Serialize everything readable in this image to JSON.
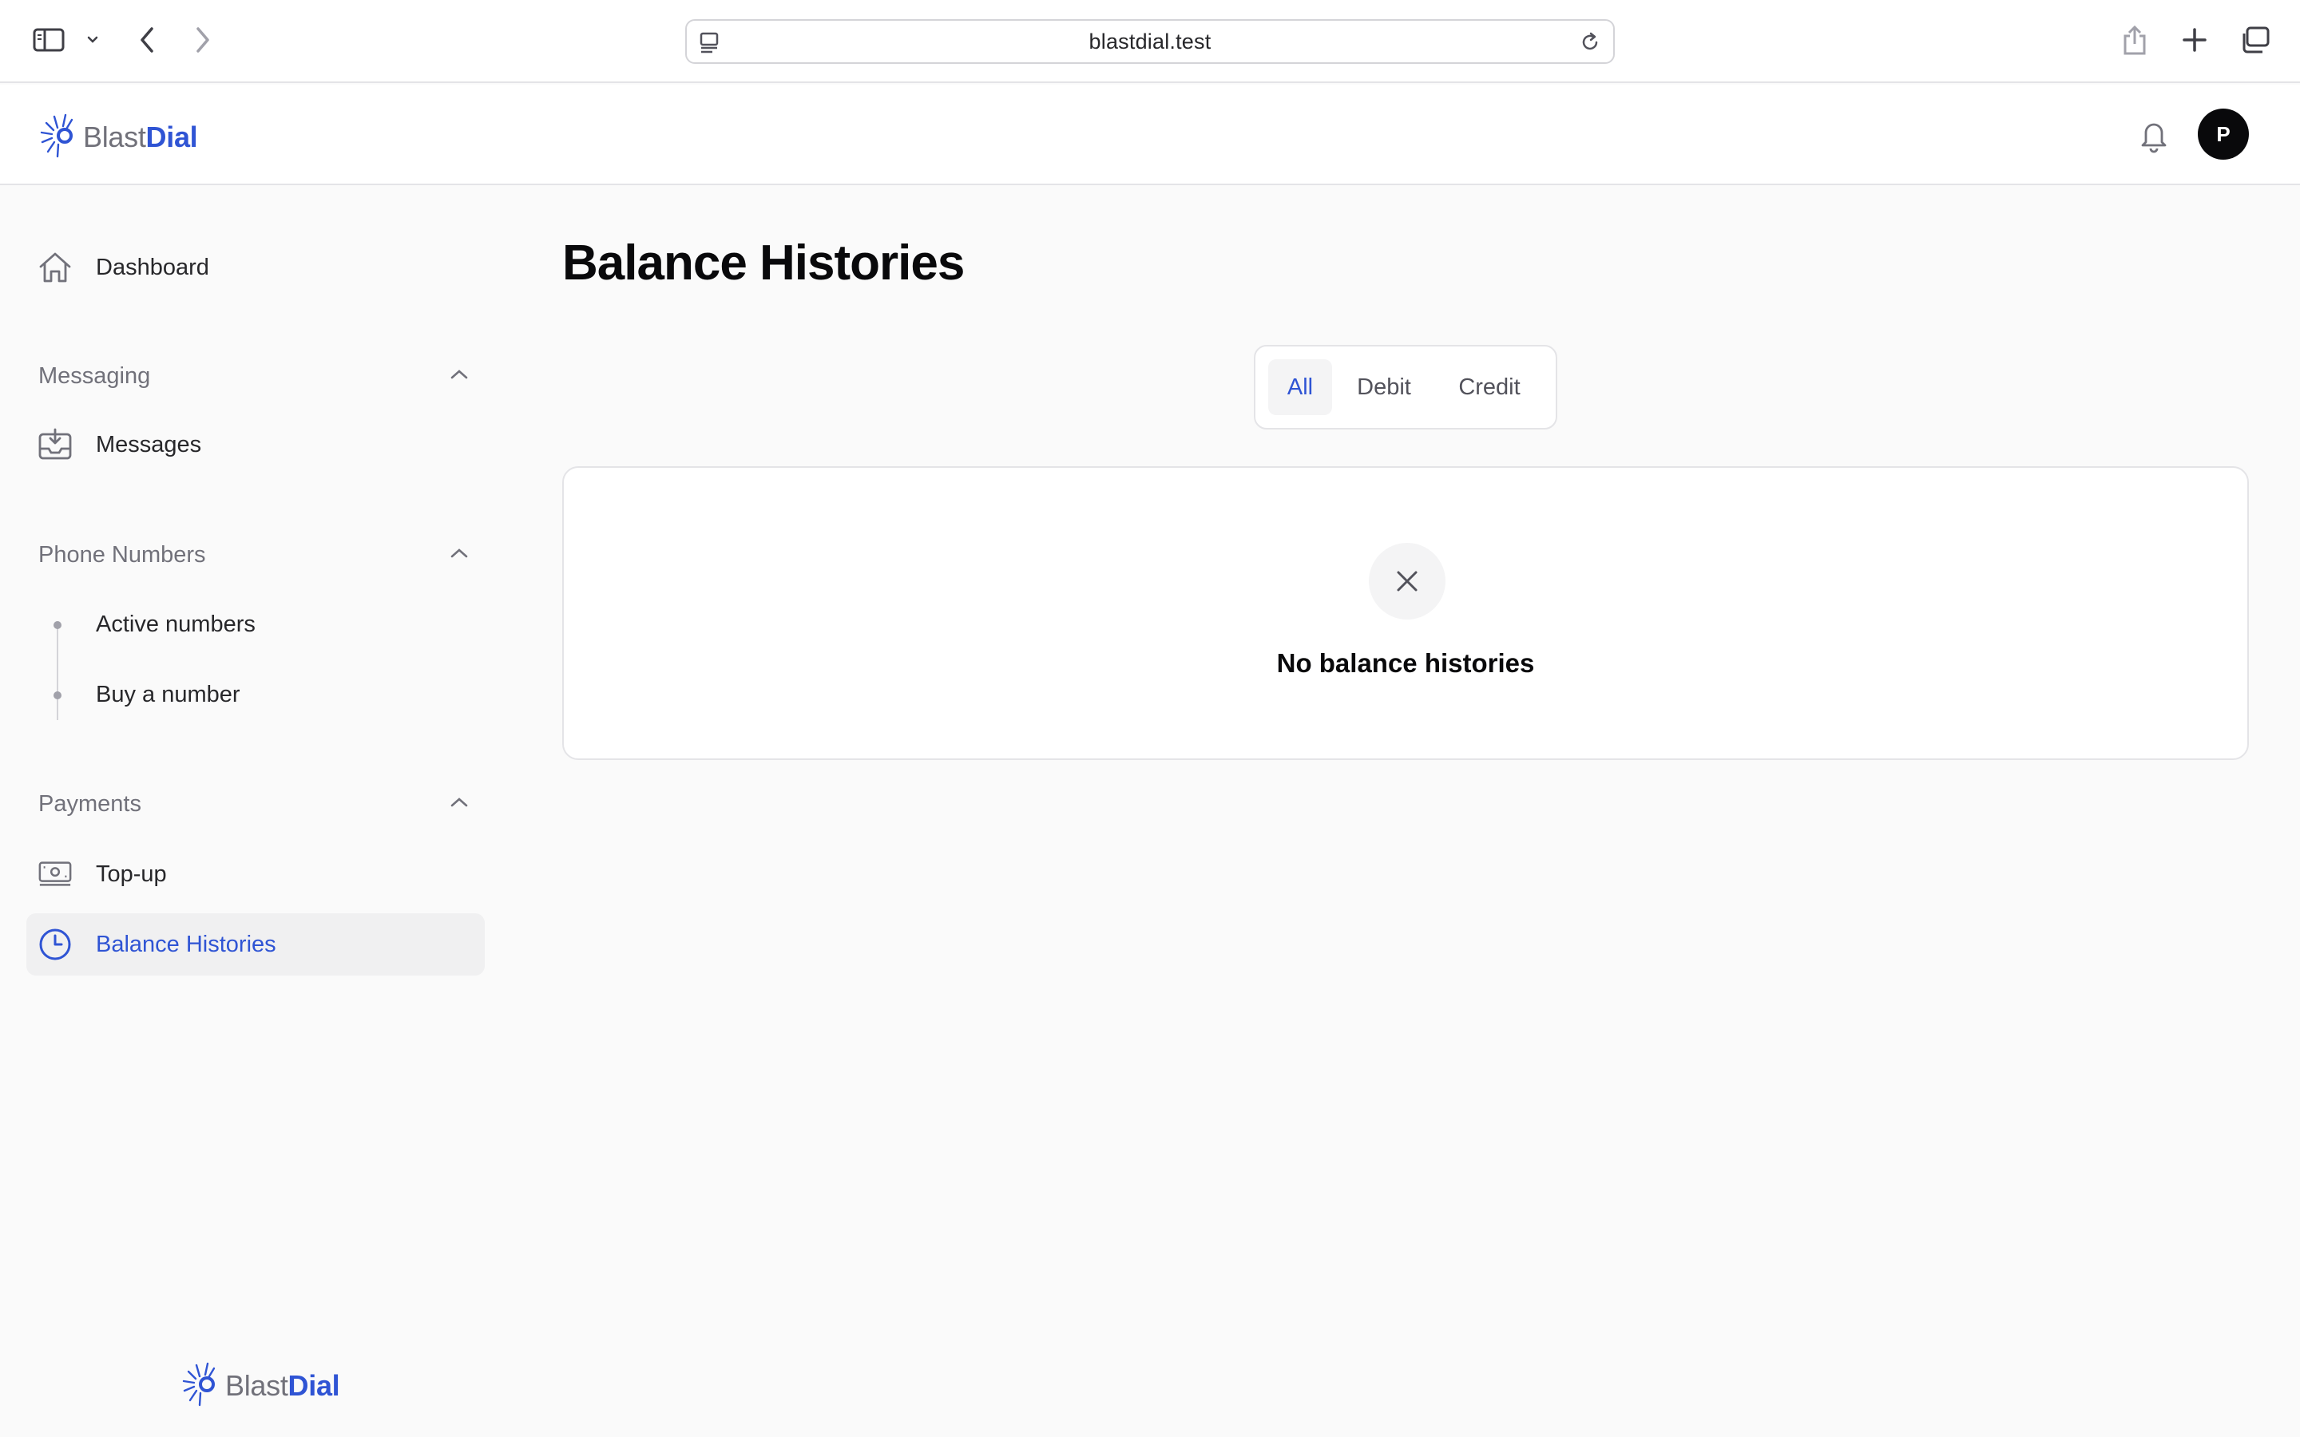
{
  "browser": {
    "url": "blastdial.test"
  },
  "brand": {
    "name_part1": "Blast",
    "name_part2": "Dial",
    "accent_color": "#2f54d4"
  },
  "header": {
    "avatar_initial": "P"
  },
  "sidebar": {
    "dashboard_label": "Dashboard",
    "sections": [
      {
        "title": "Messaging",
        "items": [
          {
            "label": "Messages",
            "icon": "inbox-icon"
          }
        ]
      },
      {
        "title": "Phone Numbers",
        "items": [
          {
            "label": "Active numbers"
          },
          {
            "label": "Buy a number"
          }
        ]
      },
      {
        "title": "Payments",
        "items": [
          {
            "label": "Top-up",
            "icon": "cash-icon"
          },
          {
            "label": "Balance Histories",
            "icon": "clock-icon",
            "active": true
          }
        ]
      }
    ]
  },
  "main": {
    "title": "Balance Histories",
    "tabs": [
      {
        "label": "All",
        "active": true
      },
      {
        "label": "Debit"
      },
      {
        "label": "Credit"
      }
    ],
    "empty_message": "No balance histories"
  }
}
